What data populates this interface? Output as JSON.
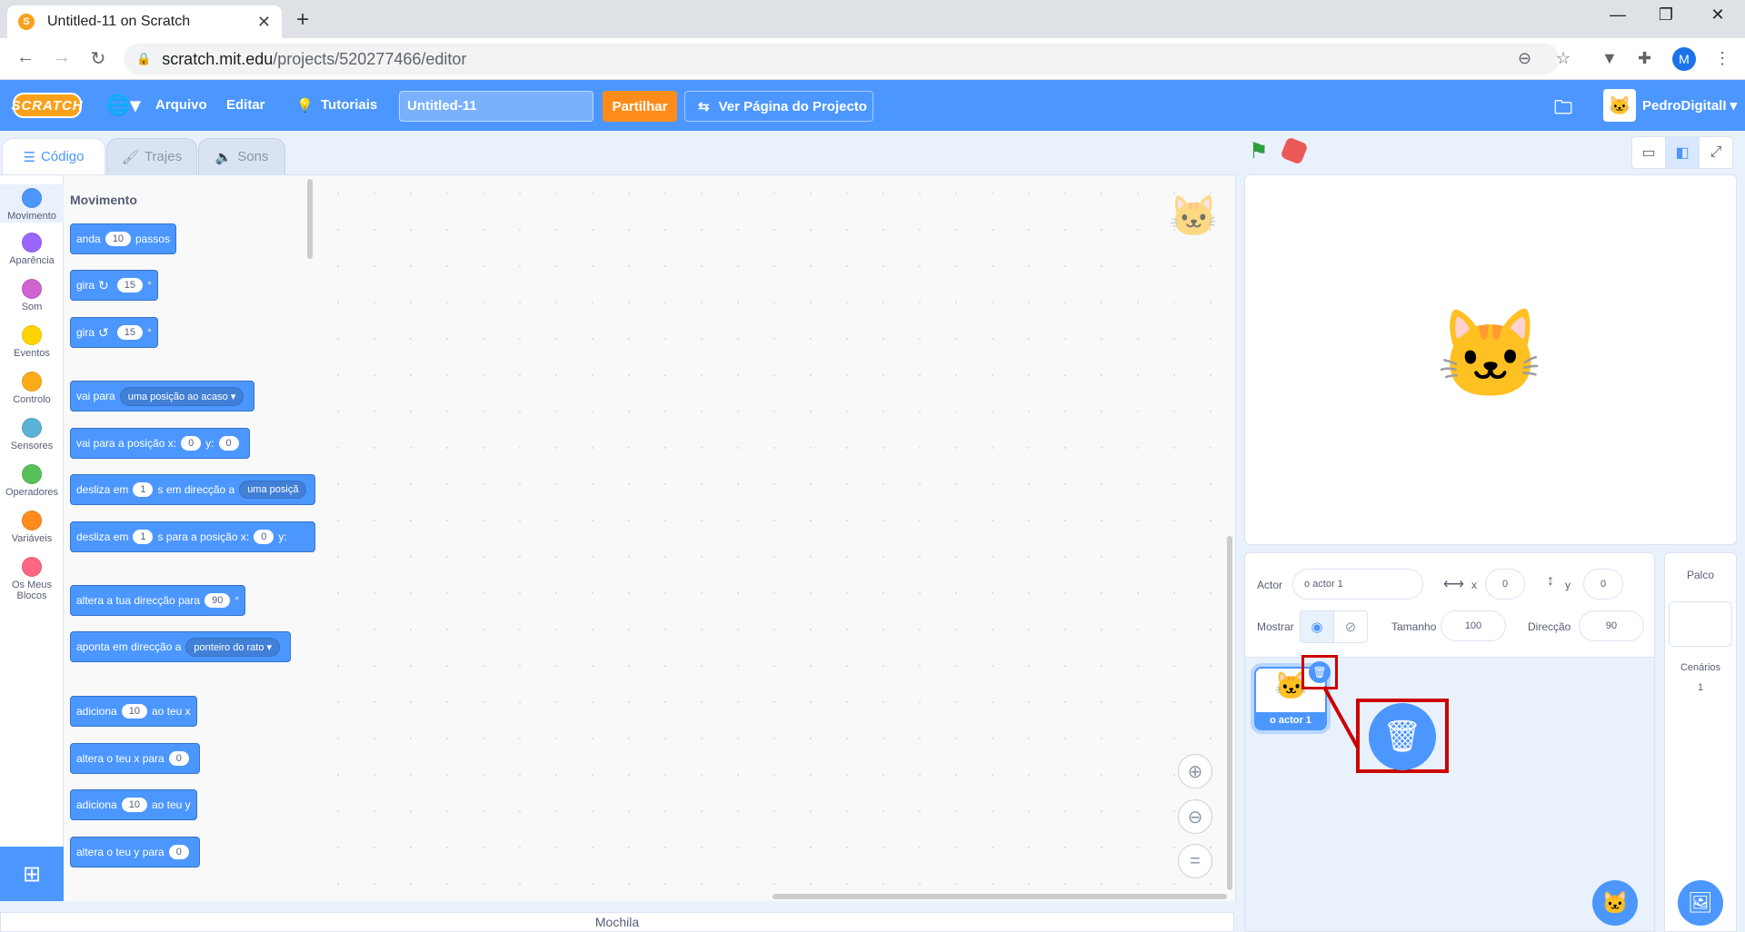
{
  "browser": {
    "tab_title": "Untitled-11 on Scratch",
    "tab_favicon": "S",
    "new_tab_glyph": "+",
    "url_host": "scratch.mit.edu",
    "url_path": "/projects/520277466/editor",
    "profile_initial": "M"
  },
  "menubar": {
    "logo": "SCRATCH",
    "file": "Arquivo",
    "edit": "Editar",
    "tutorials": "Tutoriais",
    "project_title": "Untitled-11",
    "share": "Partilhar",
    "project_page": "Ver Página do Projecto",
    "username": "PedroDigitalI"
  },
  "editor_tabs": {
    "code": "Código",
    "costumes": "Trajes",
    "sounds": "Sons"
  },
  "categories": [
    {
      "label": "Movimento",
      "color": "#4c97ff"
    },
    {
      "label": "Aparência",
      "color": "#9966ff"
    },
    {
      "label": "Som",
      "color": "#cf63cf"
    },
    {
      "label": "Eventos",
      "color": "#ffd500"
    },
    {
      "label": "Controlo",
      "color": "#ffab19"
    },
    {
      "label": "Sensores",
      "color": "#5cb1d6"
    },
    {
      "label": "Operadores",
      "color": "#59c059"
    },
    {
      "label": "Variáveis",
      "color": "#ff8c1a"
    },
    {
      "label": "Os Meus Blocos",
      "color": "#ff6680"
    }
  ],
  "palette": {
    "heading": "Movimento",
    "blocks": {
      "move": {
        "a": "anda",
        "v": "10",
        "b": "passos"
      },
      "turn_right": {
        "a": "gira",
        "v": "15",
        "b": "°"
      },
      "turn_left": {
        "a": "gira",
        "v": "15",
        "b": "°"
      },
      "goto": {
        "a": "vai para",
        "dd": "uma posição ao acaso"
      },
      "goto_xy": {
        "a": "vai para a posição x:",
        "x": "0",
        "b": "y:",
        "y": "0"
      },
      "glide_to": {
        "a": "desliza em",
        "v": "1",
        "b": "s em direcção a",
        "dd": "uma posiçã"
      },
      "glide_xy": {
        "a": "desliza em",
        "v": "1",
        "b": "s para a posição x:",
        "x": "0",
        "c": "y:"
      },
      "point_dir": {
        "a": "altera a tua direcção para",
        "v": "90",
        "b": "°"
      },
      "point_towards": {
        "a": "aponta em direcção a",
        "dd": "ponteiro do rato"
      },
      "change_x": {
        "a": "adiciona",
        "v": "10",
        "b": "ao teu x"
      },
      "set_x": {
        "a": "altera o teu x para",
        "v": "0"
      },
      "change_y": {
        "a": "adiciona",
        "v": "10",
        "b": "ao teu y"
      },
      "set_y": {
        "a": "altera o teu y para",
        "v": "0"
      }
    }
  },
  "backpack": "Mochila",
  "sprite_info": {
    "sprite_label": "Actor",
    "sprite_name": "o actor 1",
    "x_label": "x",
    "x": "0",
    "y_label": "y",
    "y": "0",
    "show_label": "Mostrar",
    "size_label": "Tamanho",
    "size": "100",
    "direction_label": "Direcção",
    "direction": "90"
  },
  "sprite_list": {
    "sprites": [
      {
        "name": "o actor 1"
      }
    ]
  },
  "stage_pane": {
    "title": "Palco",
    "backdrops_label": "Cenários",
    "backdrops_count": "1"
  }
}
